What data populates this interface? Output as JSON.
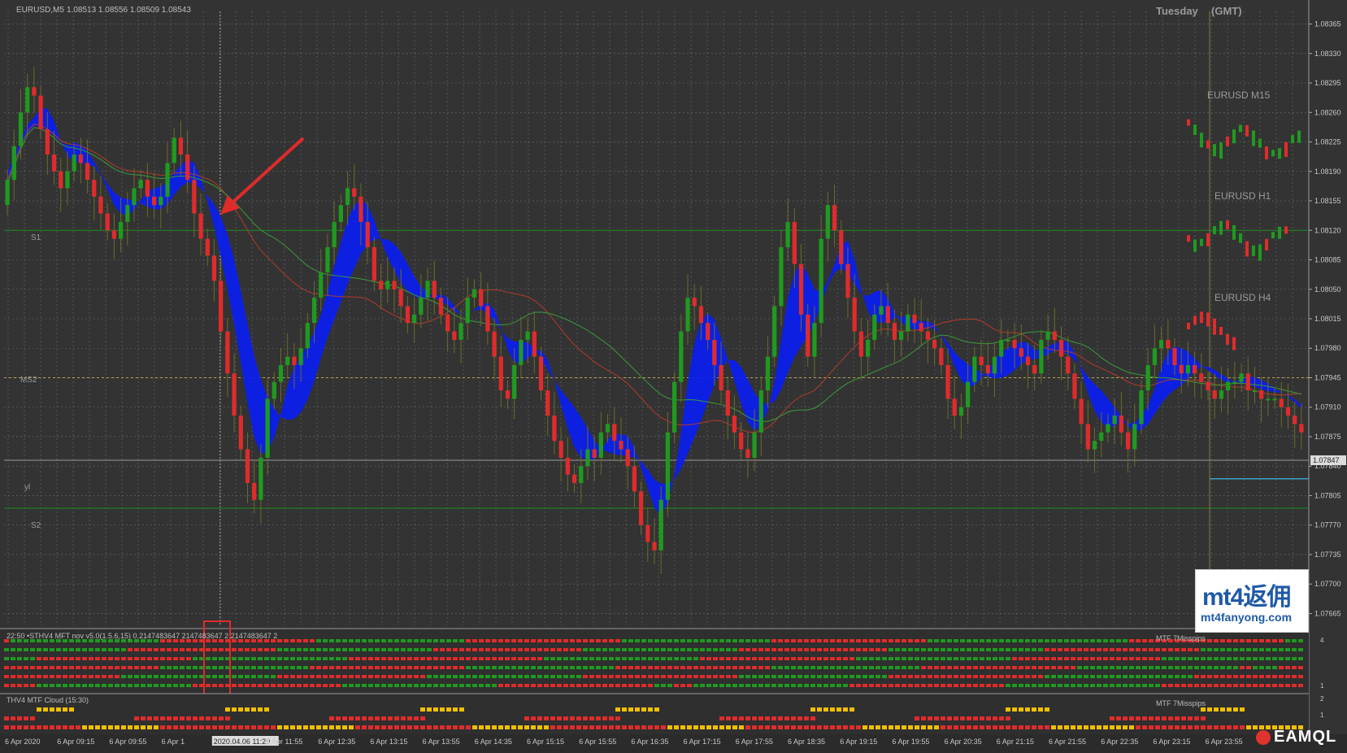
{
  "window": {
    "symbol_title": "EURUSD,M5",
    "ohlc": "1.08513 1.08556 1.08509 1.08543",
    "day_label": "Tuesday",
    "tz_label": "(GMT)"
  },
  "price_axis": [
    "1.08365",
    "1.08330",
    "1.08295",
    "1.08260",
    "1.08225",
    "1.08190",
    "1.08155",
    "1.08120",
    "1.08085",
    "1.08050",
    "1.08015",
    "1.07980",
    "1.07945",
    "1.07910",
    "1.07875",
    "1.07840",
    "1.07805",
    "1.07770",
    "1.07735",
    "1.07700",
    "1.07665"
  ],
  "current_price": "1.07847",
  "levels": {
    "s1": "S1",
    "ms2": "MS2",
    "yl": "yl",
    "s2": "S2"
  },
  "mtf_labels": {
    "m15": "EURUSD M15",
    "h1": "EURUSD H1",
    "h4": "EURUSD H4"
  },
  "indicator1": {
    "title": "22:50 •STHV4 MFT nov v5.0(1.5.6,15) 0.2147483647 2147483647 2 2147483647 2",
    "right_label": "MTF 7Misspips",
    "axis": [
      "4",
      "1"
    ]
  },
  "indicator2": {
    "title": "THV4 MTF Cloud (15:30)",
    "right_label": "MTF 7Misspips",
    "axis": [
      "2",
      "1"
    ]
  },
  "time_axis": [
    "6 Apr 2020",
    "6 Apr 09:15",
    "6 Apr 09:55",
    "6 Apr 1",
    "2020.04.06 11:20",
    "6 Apr 11:55",
    "6 Apr 12:35",
    "6 Apr 13:15",
    "6 Apr 13:55",
    "6 Apr 14:35",
    "6 Apr 15:15",
    "6 Apr 15:55",
    "6 Apr 16:35",
    "6 Apr 17:15",
    "6 Apr 17:55",
    "6 Apr 18:35",
    "6 Apr 19:15",
    "6 Apr 19:55",
    "6 Apr 20:35",
    "6 Apr 21:15",
    "6 Apr 21:55",
    "6 Apr 22:35",
    "6 Apr 23:15",
    "6 Apr 23:55"
  ],
  "watermark": {
    "brand": "mt4返佣",
    "url": "mt4fanyong.com"
  },
  "badge": "EAMQL",
  "colors": {
    "bull": "#1f9a1f",
    "bear": "#e02b2b",
    "cloud": "#0a1ef0",
    "grid": "#8a9aa8",
    "level": "#1e8c1e"
  },
  "chart_data": {
    "type": "candlestick",
    "title": "EURUSD,M5",
    "ylim": [
      1.0765,
      1.0838
    ],
    "close_series": [
      1.0818,
      1.0822,
      1.0826,
      1.0829,
      1.0828,
      1.0824,
      1.0821,
      1.0819,
      1.0817,
      1.0819,
      1.0821,
      1.082,
      1.0818,
      1.0816,
      1.0814,
      1.0812,
      1.0811,
      1.0813,
      1.0815,
      1.0817,
      1.0818,
      1.0816,
      1.0815,
      1.0816,
      1.082,
      1.0823,
      1.0821,
      1.0818,
      1.0814,
      1.0811,
      1.0809,
      1.0806,
      1.08,
      1.0795,
      1.079,
      1.0786,
      1.0782,
      1.078,
      1.0785,
      1.0792,
      1.0794,
      1.0796,
      1.0797,
      1.0796,
      1.0798,
      1.0801,
      1.0804,
      1.0807,
      1.081,
      1.0813,
      1.0815,
      1.0817,
      1.0816,
      1.0813,
      1.081,
      1.0806,
      1.0805,
      1.0806,
      1.0805,
      1.0803,
      1.0801,
      1.0802,
      1.0804,
      1.0806,
      1.0804,
      1.0802,
      1.08,
      1.0799,
      1.0801,
      1.0804,
      1.0805,
      1.0803,
      1.08,
      1.0797,
      1.0793,
      1.0792,
      1.0796,
      1.0799,
      1.08,
      1.0797,
      1.0793,
      1.079,
      1.0787,
      1.0785,
      1.0783,
      1.0782,
      1.0784,
      1.0786,
      1.0785,
      1.0788,
      1.0789,
      1.0787,
      1.0786,
      1.0784,
      1.0781,
      1.0777,
      1.0775,
      1.0774,
      1.078,
      1.0788,
      1.0794,
      1.08,
      1.0804,
      1.0803,
      1.0801,
      1.0799,
      1.0796,
      1.0793,
      1.079,
      1.0788,
      1.0786,
      1.0785,
      1.0788,
      1.0793,
      1.0797,
      1.0803,
      1.081,
      1.0813,
      1.0808,
      1.0802,
      1.0797,
      1.0801,
      1.0811,
      1.0815,
      1.0812,
      1.0808,
      1.0804,
      1.08,
      1.0797,
      1.0799,
      1.0802,
      1.0803,
      1.0801,
      1.0799,
      1.08,
      1.0802,
      1.0801,
      1.08,
      1.0799,
      1.0798,
      1.0796,
      1.0792,
      1.079,
      1.0791,
      1.0794,
      1.0797,
      1.0796,
      1.0795,
      1.0797,
      1.0799,
      1.0799,
      1.0798,
      1.0797,
      1.0796,
      1.0795,
      1.0799,
      1.08,
      1.0799,
      1.0797,
      1.0795,
      1.0792,
      1.0789,
      1.0786,
      1.0787,
      1.0788,
      1.0789,
      1.079,
      1.0788,
      1.0786,
      1.0789,
      1.0793,
      1.0796,
      1.0798,
      1.0799,
      1.0798,
      1.0796,
      1.0795,
      1.0796,
      1.0795,
      1.0794,
      1.0793,
      1.0792,
      1.0793,
      1.0794,
      1.0794,
      1.0795,
      1.0793,
      1.0793,
      1.0792,
      1.0792,
      1.0792,
      1.0791,
      1.079,
      1.0789,
      1.0788
    ]
  }
}
